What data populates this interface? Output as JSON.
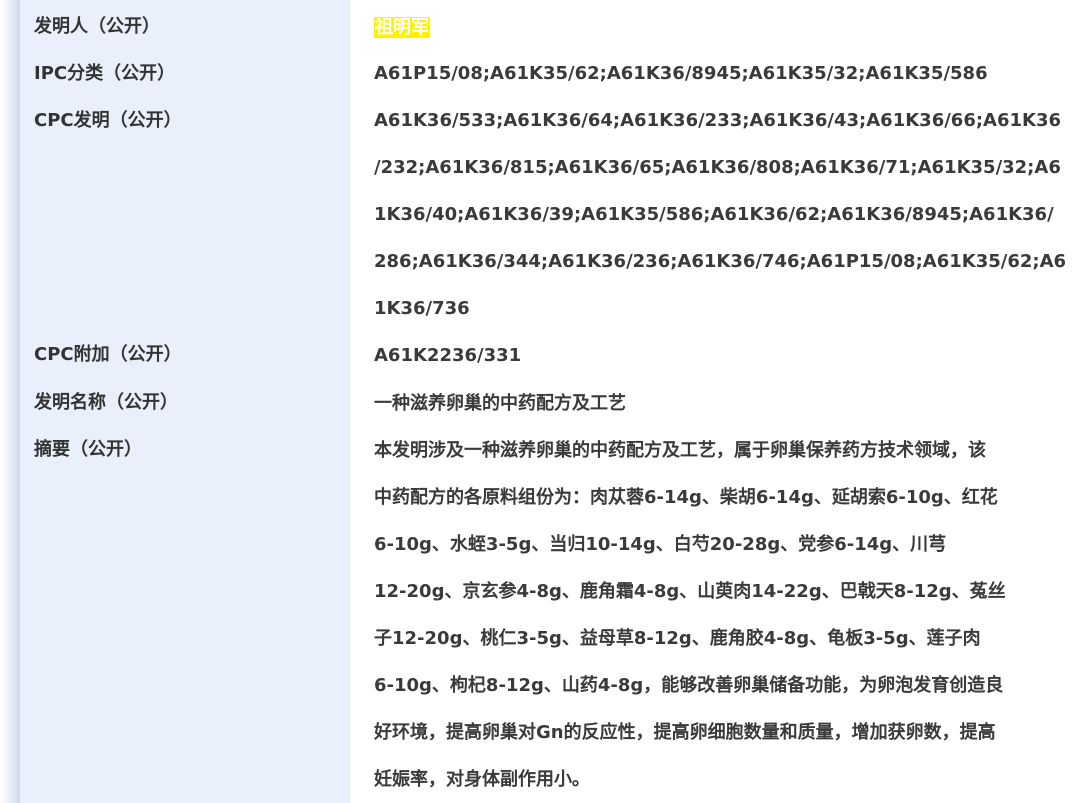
{
  "rows": {
    "inventor": {
      "label": "发明人（公开）",
      "value": "祖明军"
    },
    "ipc": {
      "label": "IPC分类（公开）",
      "value": "A61P15/08;A61K35/62;A61K36/8945;A61K35/32;A61K35/586"
    },
    "cpc_invention": {
      "label": "CPC发明（公开）",
      "lines": [
        "A61K36/533;A61K36/64;A61K36/233;A61K36/43;A61K36/66;A61K36",
        "/232;A61K36/815;A61K36/65;A61K36/808;A61K36/71;A61K35/32;A6",
        "1K36/40;A61K36/39;A61K35/586;A61K36/62;A61K36/8945;A61K36/",
        "286;A61K36/344;A61K36/236;A61K36/746;A61P15/08;A61K35/62;A6",
        "1K36/736"
      ]
    },
    "cpc_additional": {
      "label": "CPC附加（公开）",
      "value": "A61K2236/331"
    },
    "title": {
      "label": "发明名称（公开）",
      "value": "一种滋养卵巢的中药配方及工艺"
    },
    "abstract": {
      "label": "摘要（公开）",
      "lines": [
        "本发明涉及一种滋养卵巢的中药配方及工艺，属于卵巢保养药方技术领域，该",
        "中药配方的各原料组份为：肉苁蓉6-14g、柴胡6-14g、延胡索6-10g、红花",
        "6-10g、水蛭3-5g、当归10-14g、白芍20-28g、党参6-14g、川芎",
        "12-20g、京玄参4-8g、鹿角霜4-8g、山萸肉14-22g、巴戟天8-12g、菟丝",
        "子12-20g、桃仁3-5g、益母草8-12g、鹿角胶4-8g、龟板3-5g、莲子肉",
        "6-10g、枸杞8-12g、山药4-8g，能够改善卵巢储备功能，为卵泡发育创造良",
        "好环境，提高卵巢对Gn的反应性，提高卵细胞数量和质量，增加获卵数，提高",
        "妊娠率，对身体副作用小。"
      ]
    }
  }
}
